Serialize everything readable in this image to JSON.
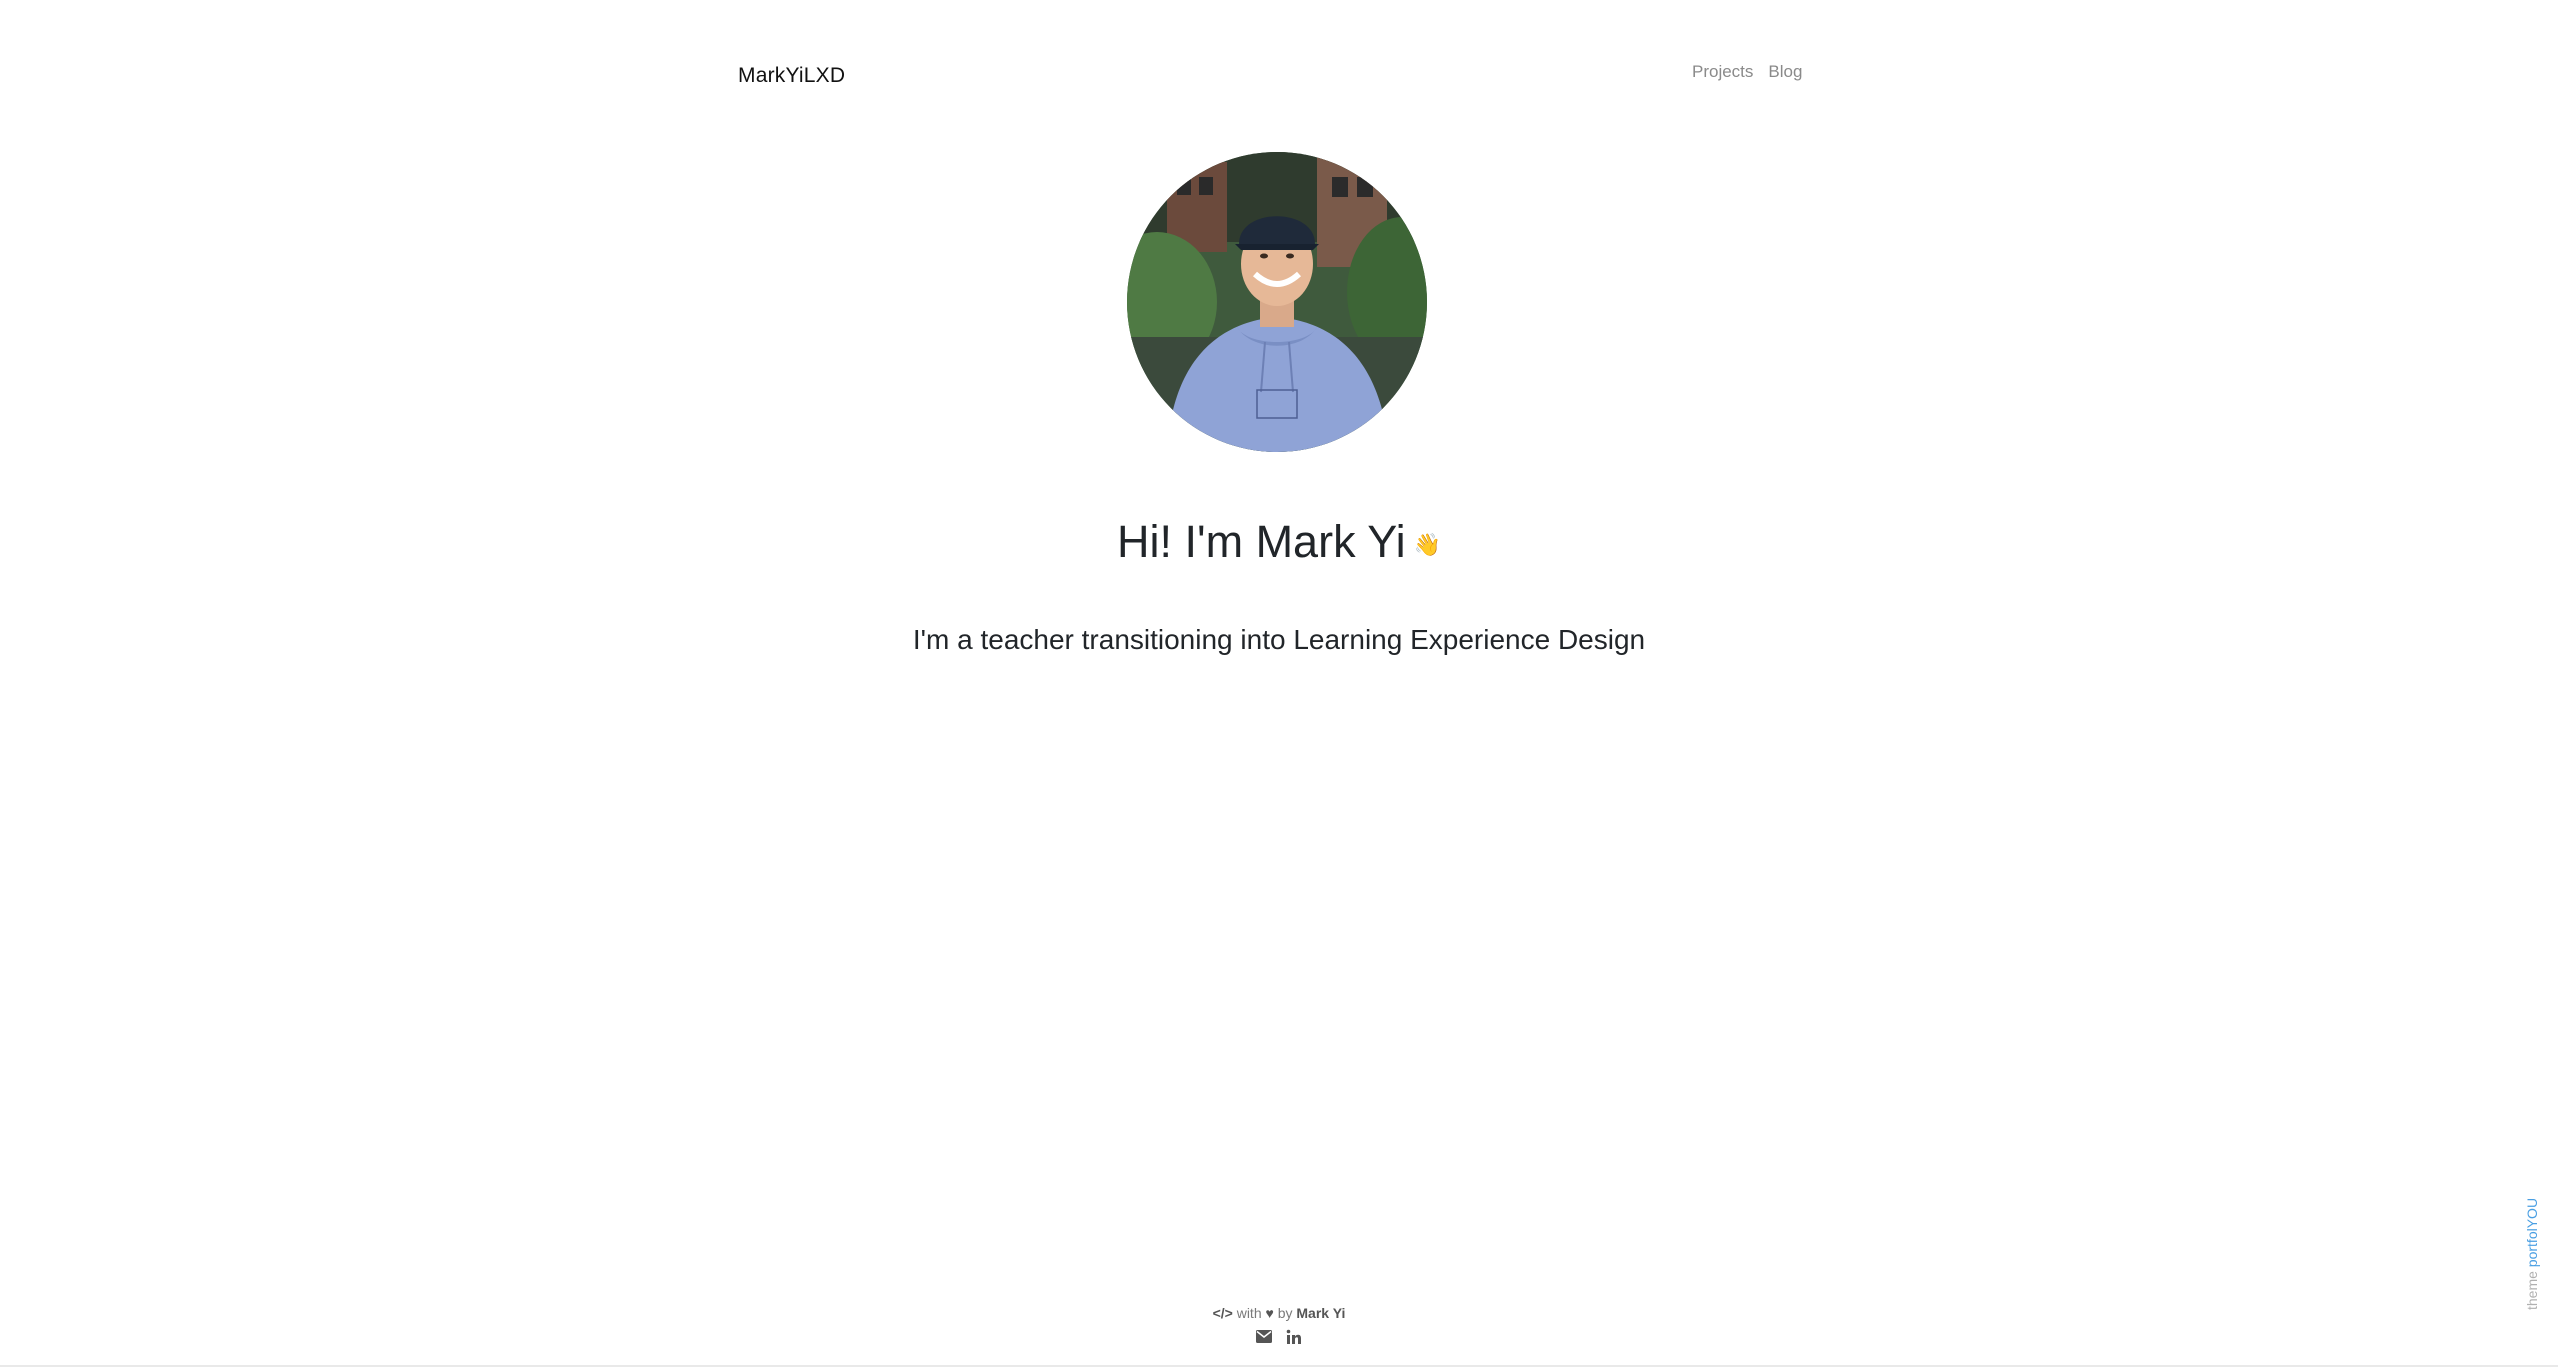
{
  "header": {
    "brand": "MarkYiLXD",
    "nav": [
      {
        "label": "Projects"
      },
      {
        "label": "Blog"
      }
    ]
  },
  "hero": {
    "avatar_alt": "Mark Yi",
    "headline": "Hi! I'm Mark Yi",
    "wave_emoji": "👋",
    "subtitle": "I'm a teacher transitioning into Learning Experience Design"
  },
  "footer": {
    "code_icon": "</>",
    "with_text": "with",
    "heart_icon": "♥",
    "by_text": "by",
    "author": "Mark Yi",
    "icons": [
      "envelope-icon",
      "linkedin-icon"
    ],
    "theme_prefix": "theme",
    "theme_name": "portfolYOU"
  },
  "colors": {
    "text": "#212529",
    "nav": "#8a8a8a",
    "theme_link": "#4a9fe3",
    "background": "#ffffff"
  }
}
